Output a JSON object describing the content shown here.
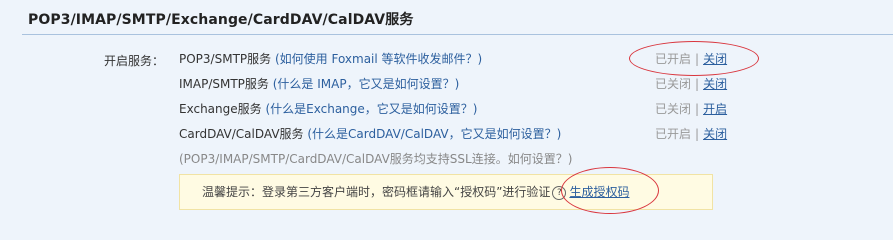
{
  "section": {
    "title": "POP3/IMAP/SMTP/Exchange/CardDAV/CalDAV服务",
    "open_label": "开启服务："
  },
  "services": [
    {
      "name": "POP3/SMTP服务",
      "help": "(如何使用 Foxmail 等软件收发邮件？)",
      "status": "已开启",
      "action": "关闭"
    },
    {
      "name": "IMAP/SMTP服务",
      "help": "(什么是 IMAP，它又是如何设置？)",
      "status": "已关闭",
      "action": "关闭"
    },
    {
      "name": "Exchange服务",
      "help": "(什么是Exchange，它又是如何设置？)",
      "status": "已关闭",
      "action": "开启"
    },
    {
      "name": "CardDAV/CalDAV服务",
      "help": "(什么是CardDAV/CalDAV，它又是如何设置？)",
      "status": "已开启",
      "action": "关闭"
    }
  ],
  "separator": "|",
  "ssl_note": {
    "text": "(POP3/IMAP/SMTP/CardDAV/CalDAV服务均支持SSL连接。",
    "link": "如何设置？)"
  },
  "tip": {
    "text": "温馨提示：登录第三方客户端时，密码框请输入“授权码”进行验证",
    "help_icon": "?",
    "link": "生成授权码"
  },
  "colors": {
    "background": "#eef4fb",
    "link": "#2c5f9e",
    "annotation": "#d9363e",
    "tip_background": "#fffbe3"
  }
}
